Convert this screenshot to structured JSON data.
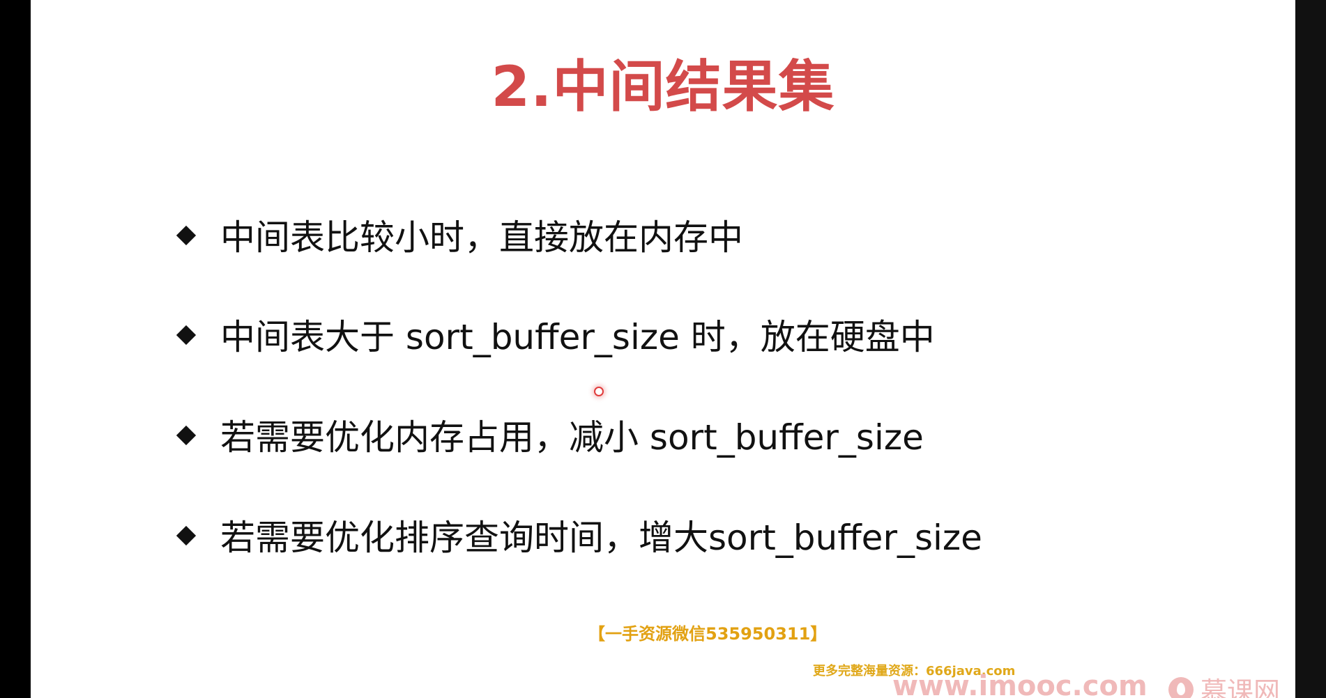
{
  "slide": {
    "title": "2.中间结果集",
    "bullets": [
      "中间表比较小时，直接放在内存中",
      "中间表大于 sort_buffer_size 时，放在硬盘中",
      "若需要优化内存占用，减小 sort_buffer_size",
      "若需要优化排序查询时间，增大sort_buffer_size"
    ]
  },
  "overlay": {
    "watermark": "【一手资源微信535950311】",
    "footer_note": "更多完整海量资源：666java.com",
    "site_url": "www.imooc.com",
    "brand_name": "慕课网"
  },
  "colors": {
    "title": "#d34a4a",
    "watermark": "#e2a112",
    "brand": "#f0b9b9"
  },
  "icons": {
    "bullet": "diamond-bullet-icon",
    "pointer": "cursor-pointer-icon",
    "brand": "imooc-logo-icon"
  }
}
